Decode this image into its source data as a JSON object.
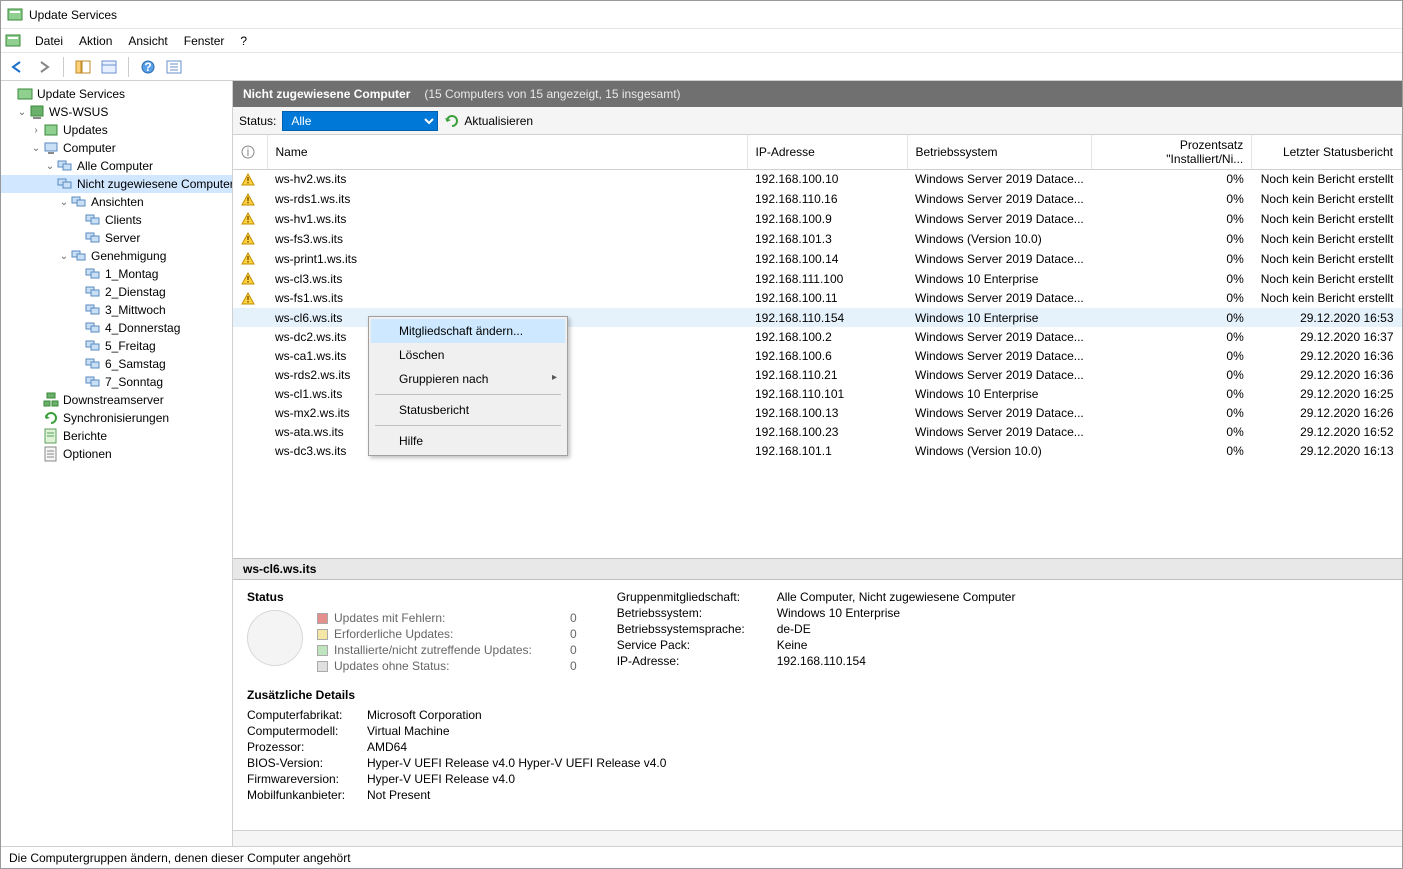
{
  "window": {
    "title": "Update Services"
  },
  "menubar": {
    "items": [
      "Datei",
      "Aktion",
      "Ansicht",
      "Fenster",
      "?"
    ]
  },
  "tree": {
    "root": "Update Services",
    "server": "WS-WSUS",
    "updates": "Updates",
    "computer": "Computer",
    "allcomputers": "Alle Computer",
    "unassigned": "Nicht zugewiesene Computer",
    "views": "Ansichten",
    "clients": "Clients",
    "serverNode": "Server",
    "approval": "Genehmigung",
    "days": [
      "1_Montag",
      "2_Dienstag",
      "3_Mittwoch",
      "4_Donnerstag",
      "5_Freitag",
      "6_Samstag",
      "7_Sonntag"
    ],
    "downstream": "Downstreamserver",
    "sync": "Synchronisierungen",
    "reports": "Berichte",
    "options": "Optionen"
  },
  "header": {
    "title": "Nicht zugewiesene Computer",
    "subtitle": "(15 Computers von 15 angezeigt, 15 insgesamt)"
  },
  "filter": {
    "statusLabel": "Status:",
    "statusValue": "Alle",
    "refresh": "Aktualisieren"
  },
  "columns": [
    "",
    "Name",
    "IP-Adresse",
    "Betriebssystem",
    "Prozentsatz \"Installiert/Ni...",
    "Letzter Statusbericht"
  ],
  "rows": [
    {
      "warn": true,
      "name": "ws-hv2.ws.its",
      "ip": "192.168.100.10",
      "os": "Windows Server 2019 Datace...",
      "pct": "0%",
      "last": "Noch kein Bericht erstellt"
    },
    {
      "warn": true,
      "name": "ws-rds1.ws.its",
      "ip": "192.168.110.16",
      "os": "Windows Server 2019 Datace...",
      "pct": "0%",
      "last": "Noch kein Bericht erstellt"
    },
    {
      "warn": true,
      "name": "ws-hv1.ws.its",
      "ip": "192.168.100.9",
      "os": "Windows Server 2019 Datace...",
      "pct": "0%",
      "last": "Noch kein Bericht erstellt"
    },
    {
      "warn": true,
      "name": "ws-fs3.ws.its",
      "ip": "192.168.101.3",
      "os": "Windows (Version 10.0)",
      "pct": "0%",
      "last": "Noch kein Bericht erstellt"
    },
    {
      "warn": true,
      "name": "ws-print1.ws.its",
      "ip": "192.168.100.14",
      "os": "Windows Server 2019 Datace...",
      "pct": "0%",
      "last": "Noch kein Bericht erstellt"
    },
    {
      "warn": true,
      "name": "ws-cl3.ws.its",
      "ip": "192.168.111.100",
      "os": "Windows 10 Enterprise",
      "pct": "0%",
      "last": "Noch kein Bericht erstellt"
    },
    {
      "warn": true,
      "name": "ws-fs1.ws.its",
      "ip": "192.168.100.11",
      "os": "Windows Server 2019 Datace...",
      "pct": "0%",
      "last": "Noch kein Bericht erstellt"
    },
    {
      "warn": false,
      "name": "ws-cl6.ws.its",
      "ip": "192.168.110.154",
      "os": "Windows 10 Enterprise",
      "pct": "0%",
      "last": "29.12.2020 16:53",
      "sel": true
    },
    {
      "warn": false,
      "name": "ws-dc2.ws.its",
      "ip": "192.168.100.2",
      "os": "Windows Server 2019 Datace...",
      "pct": "0%",
      "last": "29.12.2020 16:37"
    },
    {
      "warn": false,
      "name": "ws-ca1.ws.its",
      "ip": "192.168.100.6",
      "os": "Windows Server 2019 Datace...",
      "pct": "0%",
      "last": "29.12.2020 16:36"
    },
    {
      "warn": false,
      "name": "ws-rds2.ws.its",
      "ip": "192.168.110.21",
      "os": "Windows Server 2019 Datace...",
      "pct": "0%",
      "last": "29.12.2020 16:36"
    },
    {
      "warn": false,
      "name": "ws-cl1.ws.its",
      "ip": "192.168.110.101",
      "os": "Windows 10 Enterprise",
      "pct": "0%",
      "last": "29.12.2020 16:25"
    },
    {
      "warn": false,
      "name": "ws-mx2.ws.its",
      "ip": "192.168.100.13",
      "os": "Windows Server 2019 Datace...",
      "pct": "0%",
      "last": "29.12.2020 16:26"
    },
    {
      "warn": false,
      "name": "ws-ata.ws.its",
      "ip": "192.168.100.23",
      "os": "Windows Server 2019 Datace...",
      "pct": "0%",
      "last": "29.12.2020 16:52"
    },
    {
      "warn": false,
      "name": "ws-dc3.ws.its",
      "ip": "192.168.101.1",
      "os": "Windows (Version 10.0)",
      "pct": "0%",
      "last": "29.12.2020 16:13"
    }
  ],
  "context": {
    "changeMembership": "Mitgliedschaft ändern...",
    "delete": "Löschen",
    "groupBy": "Gruppieren nach",
    "statusReport": "Statusbericht",
    "help": "Hilfe"
  },
  "detailHeader": "ws-cl6.ws.its",
  "status": {
    "heading": "Status",
    "legend": [
      {
        "color": "#e58f8c",
        "label": "Updates mit Fehlern:",
        "val": "0"
      },
      {
        "color": "#f4e7a5",
        "label": "Erforderliche Updates:",
        "val": "0"
      },
      {
        "color": "#bfe5bf",
        "label": "Installierte/nicht zutreffende Updates:",
        "val": "0"
      },
      {
        "color": "#e0e0e0",
        "label": "Updates ohne Status:",
        "val": "0"
      }
    ]
  },
  "props": {
    "labels": {
      "group": "Gruppenmitgliedschaft:",
      "os": "Betriebssystem:",
      "lang": "Betriebssystemsprache:",
      "sp": "Service Pack:",
      "ip": "IP-Adresse:"
    },
    "group": "Alle Computer, Nicht zugewiesene Computer",
    "os": "Windows 10 Enterprise",
    "lang": "de-DE",
    "sp": "Keine",
    "ip": "192.168.110.154"
  },
  "extra": {
    "heading": "Zusätzliche Details",
    "labels": {
      "make": "Computerfabrikat:",
      "model": "Computermodell:",
      "proc": "Prozessor:",
      "bios": "BIOS-Version:",
      "fw": "Firmwareversion:",
      "mobile": "Mobilfunkanbieter:"
    },
    "make": "Microsoft Corporation",
    "model": "Virtual Machine",
    "proc": "AMD64",
    "bios": "Hyper-V UEFI Release v4.0 Hyper-V UEFI Release v4.0",
    "fw": "Hyper-V UEFI Release v4.0",
    "mobile": "Not Present"
  },
  "statusbar": "Die Computergruppen ändern, denen dieser Computer angehört"
}
